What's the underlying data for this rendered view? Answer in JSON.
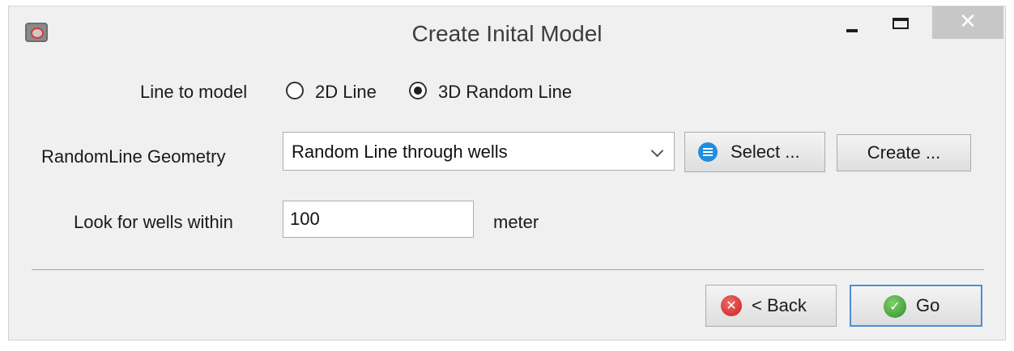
{
  "window": {
    "title": "Create Inital Model",
    "close_glyph": "✕",
    "icons": {
      "app": "app-logo-icon",
      "minimize": "minimize-icon",
      "maximize": "maximize-icon",
      "close": "close-icon"
    }
  },
  "line_to_model": {
    "label": "Line to model",
    "options": [
      {
        "label": "2D Line",
        "selected": false
      },
      {
        "label": "3D Random Line",
        "selected": true
      }
    ]
  },
  "geometry": {
    "label": "RandomLine Geometry",
    "selected": "Random Line through wells",
    "select_button": "Select ...",
    "select_icon": "list-icon",
    "create_button": "Create ..."
  },
  "wells": {
    "label": "Look for wells within",
    "value": "100",
    "unit": "meter"
  },
  "footer": {
    "back_button": "< Back",
    "back_icon": "cancel-x-icon",
    "back_glyph": "✕",
    "go_button": "Go",
    "go_icon": "checkmark-icon",
    "go_glyph": "✓"
  },
  "colors": {
    "accent_blue": "#1d8fe0",
    "back_red": "#c81e1e",
    "go_green": "#2e8f2a",
    "go_border": "#4a8fd6"
  }
}
